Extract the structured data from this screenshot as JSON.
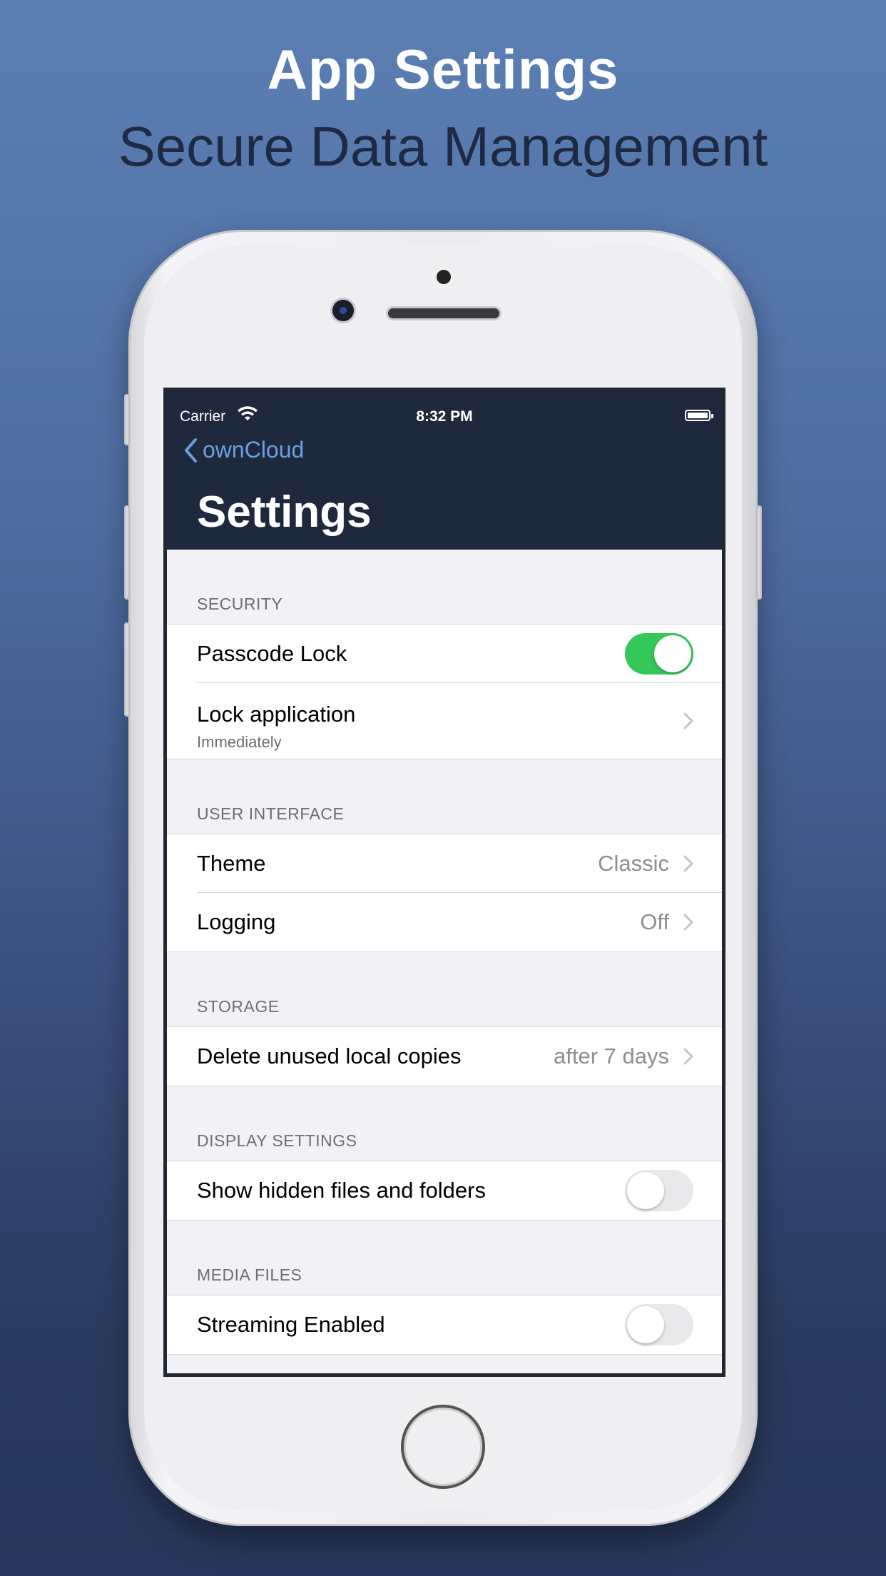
{
  "promo": {
    "headline": "App Settings",
    "subheadline": "Secure Data Management"
  },
  "status_bar": {
    "carrier": "Carrier",
    "time": "8:32 PM"
  },
  "nav": {
    "back_label": "ownCloud",
    "title": "Settings"
  },
  "sections": {
    "security": {
      "header": "SECURITY",
      "passcode_lock": {
        "label": "Passcode Lock",
        "enabled": true
      },
      "lock_application": {
        "label": "Lock application",
        "subtitle": "Immediately"
      }
    },
    "user_interface": {
      "header": "USER INTERFACE",
      "theme": {
        "label": "Theme",
        "value": "Classic"
      },
      "logging": {
        "label": "Logging",
        "value": "Off"
      }
    },
    "storage": {
      "header": "STORAGE",
      "delete_unused": {
        "label": "Delete unused local copies",
        "value": "after 7 days"
      }
    },
    "display_settings": {
      "header": "DISPLAY SETTINGS",
      "show_hidden": {
        "label": "Show hidden files and folders",
        "enabled": false
      }
    },
    "media_files": {
      "header": "MEDIA FILES",
      "streaming": {
        "label": "Streaming Enabled",
        "enabled": false
      }
    }
  },
  "colors": {
    "accent": "#6a9fe0",
    "toggle_on": "#34c759",
    "nav_background": "#1f293d"
  }
}
